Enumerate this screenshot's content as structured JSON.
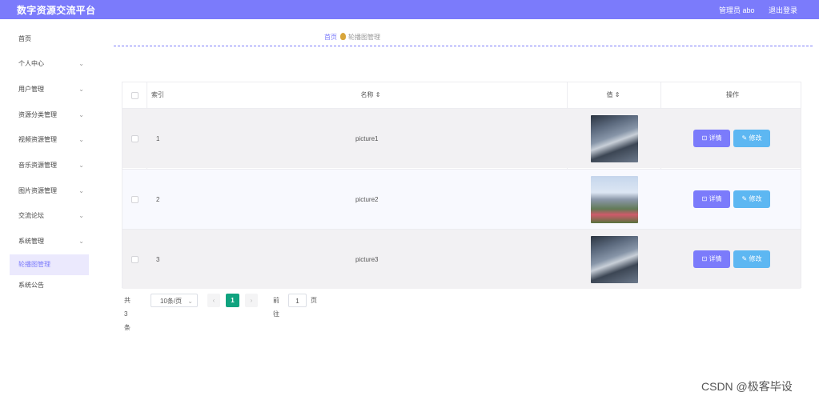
{
  "header": {
    "brand": "数字资源交流平台",
    "admin": "管理员 abo",
    "logout": "退出登录"
  },
  "sidebar": {
    "items": [
      {
        "label": "首页",
        "chevron": ""
      },
      {
        "label": "个人中心",
        "chevron": "⌄"
      },
      {
        "label": "用户管理",
        "chevron": "⌄"
      },
      {
        "label": "资源分类管理",
        "chevron": "⌄"
      },
      {
        "label": "视频资源管理",
        "chevron": "⌄"
      },
      {
        "label": "音乐资源管理",
        "chevron": "⌄"
      },
      {
        "label": "图片资源管理",
        "chevron": "⌄"
      },
      {
        "label": "交流论坛",
        "chevron": "⌄"
      },
      {
        "label": "系统管理",
        "chevron": "⌄"
      },
      {
        "label": "轮播图管理",
        "chevron": "",
        "active": true
      },
      {
        "label": "系统公告",
        "chevron": ""
      }
    ]
  },
  "breadcrumb": {
    "home": "首页",
    "current": "轮播图管理"
  },
  "table": {
    "headers": {
      "index": "索引",
      "name": "名称",
      "value": "值",
      "sort_icon": "⇕",
      "actions": "操作"
    },
    "rows": [
      {
        "index": "1",
        "name": "picture1",
        "thumb": "a"
      },
      {
        "index": "2",
        "name": "picture2",
        "thumb": "b"
      },
      {
        "index": "3",
        "name": "picture3",
        "thumb": "a"
      }
    ],
    "detail_label": "⊡ 详情",
    "edit_label": "✎ 修改"
  },
  "pagination": {
    "total": "共 3 条",
    "page_size": "10条/页",
    "prev": "‹",
    "current": "1",
    "next": "›",
    "goto_label": "前往",
    "goto_value": "1",
    "page_suffix": "页"
  },
  "watermark": "CSDN @极客毕设",
  "colors": {
    "accent": "#7b7bfb",
    "edit": "#5db7f2",
    "page_active": "#10a37f"
  }
}
